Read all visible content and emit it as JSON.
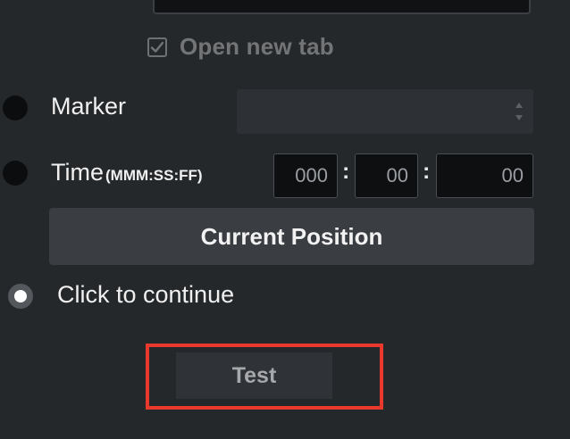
{
  "open_new_tab": {
    "label": "Open new tab",
    "checked": true
  },
  "options": {
    "marker_label": "Marker",
    "time_label": "Time",
    "time_format": "(MMM:SS:FF)",
    "click_label": "Click to continue",
    "selected": "Click to continue"
  },
  "time": {
    "minutes": "000",
    "seconds": "00",
    "frames": "00",
    "separator": ":"
  },
  "buttons": {
    "current_position": "Current Position",
    "test": "Test"
  },
  "icons": {
    "checkbox": "check-icon",
    "spinner": "spinner-arrows-icon"
  },
  "colors": {
    "background": "#25282b",
    "highlight": "#e8392c"
  }
}
